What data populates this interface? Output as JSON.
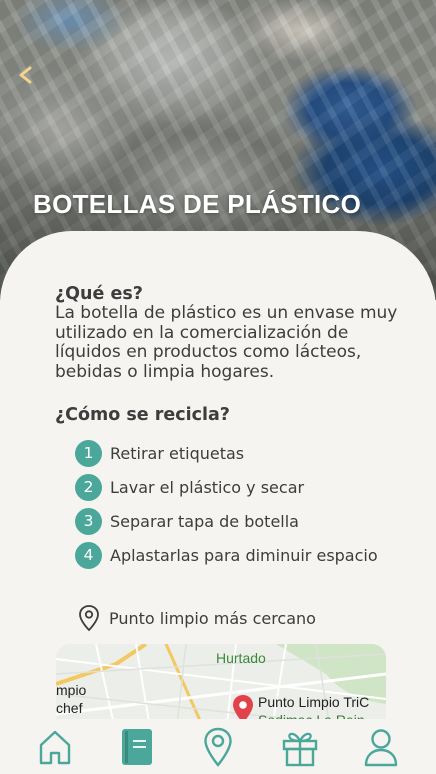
{
  "header": {
    "title": "BOTELLAS DE PLÁSTICO",
    "back_icon": "chevron-left-icon"
  },
  "what_is": {
    "heading": "¿Qué es?",
    "text": "La botella de plástico es un envase muy utilizado en la comercialización de líquidos en productos como lácteos, bebidas o limpia hogares."
  },
  "how_to_recycle": {
    "heading": "¿Cómo se recicla?",
    "steps": [
      {
        "number": "1",
        "label": "Retirar etiquetas"
      },
      {
        "number": "2",
        "label": "Lavar el plástico y secar"
      },
      {
        "number": "3",
        "label": "Separar tapa de botella"
      },
      {
        "number": "4",
        "label": "Aplastarlas para diminuir espacio"
      }
    ]
  },
  "nearest_point": {
    "label": "Punto limpio más cercano",
    "icon": "map-pin-outline-icon"
  },
  "map": {
    "labels": {
      "district": "Hurtado",
      "left_top": "mpio",
      "left_bottom": "chef",
      "place": "Punto Limpio TriC",
      "place_sub": "Sodimac La Rein"
    },
    "pin_color": "#e2434b"
  },
  "nav": {
    "items": [
      {
        "name": "home",
        "icon": "home-icon",
        "active": false
      },
      {
        "name": "guide",
        "icon": "book-icon",
        "active": true
      },
      {
        "name": "locations",
        "icon": "map-pin-icon",
        "active": false
      },
      {
        "name": "rewards",
        "icon": "gift-icon",
        "active": false
      },
      {
        "name": "profile",
        "icon": "user-icon",
        "active": false
      }
    ]
  },
  "colors": {
    "accent": "#4aa79a",
    "text": "#3d3d3d",
    "background": "#f6f4f1"
  }
}
